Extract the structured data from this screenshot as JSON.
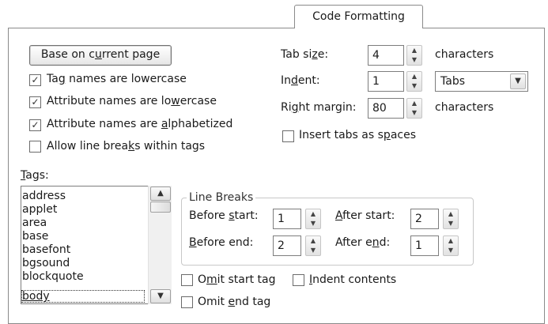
{
  "tab": {
    "label": "Code Formatting"
  },
  "base_button": {
    "label_pre": "Base on c",
    "label_u": "u",
    "label_post": "rrent page"
  },
  "checkboxes": {
    "tag_lower": {
      "pre": "Ta",
      "u": "g",
      "post": " names are lowercase",
      "checked": true
    },
    "attr_lower": {
      "pre": "Attribute names are lo",
      "u": "w",
      "post": "ercase",
      "checked": true
    },
    "attr_alpha": {
      "pre": "Attribute names are ",
      "u": "a",
      "post": "lphabetized",
      "checked": true
    },
    "line_breaks": {
      "pre": "Allow line brea",
      "u": "k",
      "post": "s within tags",
      "checked": false
    },
    "insert_tabs": {
      "pre": "Insert tabs as s",
      "u": "p",
      "post": "aces",
      "checked": false
    },
    "omit_start": {
      "pre": "O",
      "u": "m",
      "post": "it start tag",
      "checked": false
    },
    "indent_contents": {
      "pre": "",
      "u": "I",
      "post": "ndent contents",
      "checked": false
    },
    "omit_end": {
      "pre": "Omit ",
      "u": "e",
      "post": "nd tag",
      "checked": false
    }
  },
  "tab_size": {
    "pre": "Tab si",
    "u": "z",
    "post": "e:",
    "value": "4",
    "unit": "characters"
  },
  "indent": {
    "pre": "In",
    "u": "d",
    "post": "ent:",
    "value": "1",
    "mode": "Tabs"
  },
  "right_margin": {
    "pre": "Ri",
    "u": "g",
    "post": "ht margin:",
    "value": "80",
    "unit": "characters"
  },
  "tags": {
    "label_u": "T",
    "label_post": "ags:",
    "items": [
      "address",
      "applet",
      "area",
      "base",
      "basefont",
      "bgsound",
      "blockquote",
      "body"
    ],
    "selected": "body"
  },
  "line_breaks_group": {
    "title": "Line Breaks",
    "before_start": {
      "pre": "Before ",
      "u": "s",
      "post": "tart:",
      "value": "1"
    },
    "after_start": {
      "pre": "",
      "u": "A",
      "post": "fter start:",
      "value": "2"
    },
    "before_end": {
      "pre": "",
      "u": "B",
      "post": "efore end:",
      "value": "2"
    },
    "after_end": {
      "pre": "After e",
      "u": "n",
      "post": "d:",
      "value": "1"
    }
  },
  "icons": {
    "check": "✓",
    "spin_up": "▲",
    "spin_down": "▼",
    "dropdown": "▼"
  }
}
